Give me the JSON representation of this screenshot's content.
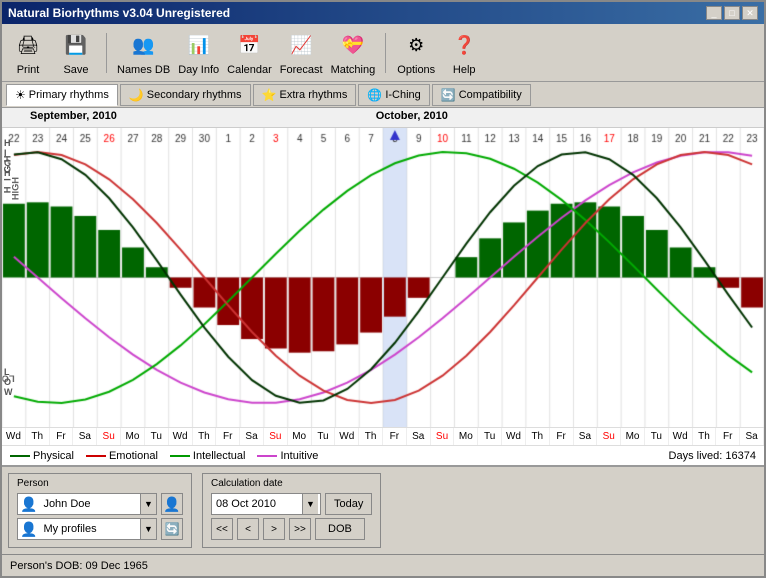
{
  "window": {
    "title": "Natural Biorhythms v3.04 Unregistered"
  },
  "toolbar": {
    "buttons": [
      {
        "id": "print",
        "icon": "🖨",
        "label": "Print"
      },
      {
        "id": "save",
        "icon": "💾",
        "label": "Save"
      },
      {
        "id": "names-db",
        "icon": "👥",
        "label": "Names DB"
      },
      {
        "id": "day-info",
        "icon": "📊",
        "label": "Day Info"
      },
      {
        "id": "calendar",
        "icon": "📅",
        "label": "Calendar"
      },
      {
        "id": "forecast",
        "icon": "📈",
        "label": "Forecast"
      },
      {
        "id": "matching",
        "icon": "💝",
        "label": "Matching"
      },
      {
        "id": "options",
        "icon": "⚙",
        "label": "Options"
      },
      {
        "id": "help",
        "icon": "❓",
        "label": "Help"
      }
    ]
  },
  "tabs": [
    {
      "id": "primary",
      "label": "Primary rhythms",
      "icon": "☀",
      "active": true
    },
    {
      "id": "secondary",
      "label": "Secondary rhythms",
      "icon": "🌙",
      "active": false
    },
    {
      "id": "extra",
      "label": "Extra rhythms",
      "icon": "⭐",
      "active": false
    },
    {
      "id": "iching",
      "label": "I-Ching",
      "icon": "🌐",
      "active": false
    },
    {
      "id": "compatibility",
      "label": "Compatibility",
      "icon": "🔄",
      "active": false
    }
  ],
  "chart": {
    "months": [
      {
        "label": "September, 2010",
        "position": 0
      },
      {
        "label": "October, 2010",
        "position": 50
      }
    ],
    "dates": [
      "22",
      "23",
      "24",
      "25",
      "26",
      "27",
      "28",
      "29",
      "30",
      "1",
      "2",
      "3",
      "4",
      "5",
      "6",
      "7",
      "8",
      "9",
      "10",
      "11",
      "12",
      "13",
      "14",
      "15",
      "16",
      "17",
      "18",
      "19",
      "20",
      "21",
      "22",
      "23"
    ],
    "days": [
      "Wd",
      "Th",
      "Fr",
      "Sa",
      "Su",
      "Mo",
      "Tu",
      "Wd",
      "Th",
      "Fr",
      "Sa",
      "Su",
      "Mo",
      "Tu",
      "Wd",
      "Th",
      "Fr",
      "Sa",
      "Su",
      "Mo",
      "Tu",
      "Wd",
      "Th",
      "Fr",
      "Sa",
      "Su",
      "Mo",
      "Tu",
      "Wd",
      "Th",
      "Fr",
      "Sa"
    ],
    "sunday_indices": [
      4,
      11,
      18,
      25
    ],
    "today_index": 16,
    "high_label": "HIGH",
    "low_label": "LOW",
    "days_lived": "Days lived: 16374"
  },
  "legend": {
    "items": [
      {
        "label": "Physical",
        "color": "#006600"
      },
      {
        "label": "Emotional",
        "color": "#cc0000"
      },
      {
        "label": "Intellectual",
        "color": "#009900"
      },
      {
        "label": "Intuitive",
        "color": "#cc44cc"
      }
    ]
  },
  "person_panel": {
    "title": "Person",
    "name": "John Doe",
    "profiles": "My profiles"
  },
  "calc_panel": {
    "title": "Calculation date",
    "date": "08 Oct 2010",
    "today_btn": "Today",
    "dob_btn": "DOB",
    "nav": [
      "<<",
      "<",
      ">",
      ">>"
    ]
  },
  "status_bar": {
    "text": "Person's DOB: 09 Dec 1965"
  }
}
